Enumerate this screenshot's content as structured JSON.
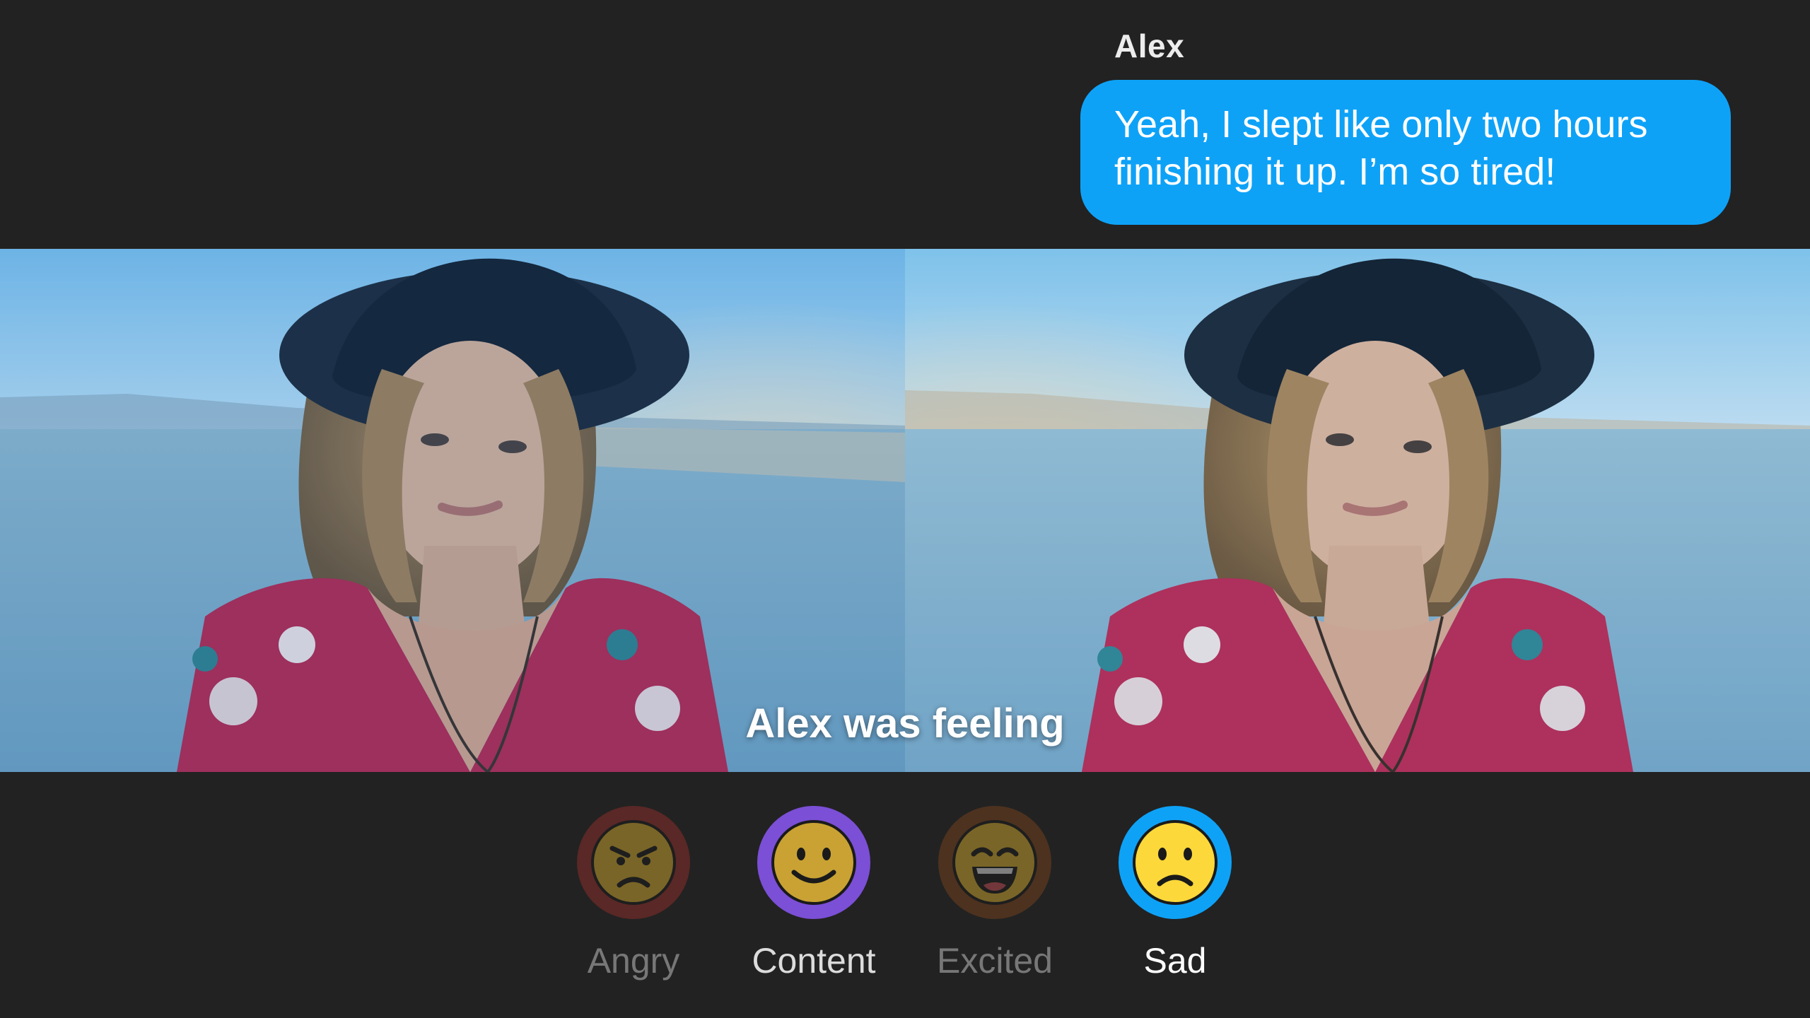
{
  "message": {
    "sender": "Alex",
    "text": "Yeah, I slept like only two hours finishing it up. I’m so tired!",
    "bubble_color": "#0ea2f7"
  },
  "prompt": {
    "caption": "Alex was feeling"
  },
  "photos": [
    {
      "icon": "portrait-photo",
      "variant": "original"
    },
    {
      "icon": "portrait-photo",
      "variant": "filtered"
    }
  ],
  "choices": [
    {
      "label": "Angry",
      "icon": "angry-face-icon",
      "ring_color": "#a8322d",
      "selected": false,
      "dimmed": true
    },
    {
      "label": "Content",
      "icon": "smiling-face-icon",
      "ring_color": "#7b4fd6",
      "selected": false,
      "dimmed": false
    },
    {
      "label": "Excited",
      "icon": "grinning-face-icon",
      "ring_color": "#8a4a1c",
      "selected": false,
      "dimmed": true
    },
    {
      "label": "Sad",
      "icon": "frowning-face-icon",
      "ring_color": "#0ea2f7",
      "selected": true,
      "dimmed": false
    }
  ]
}
